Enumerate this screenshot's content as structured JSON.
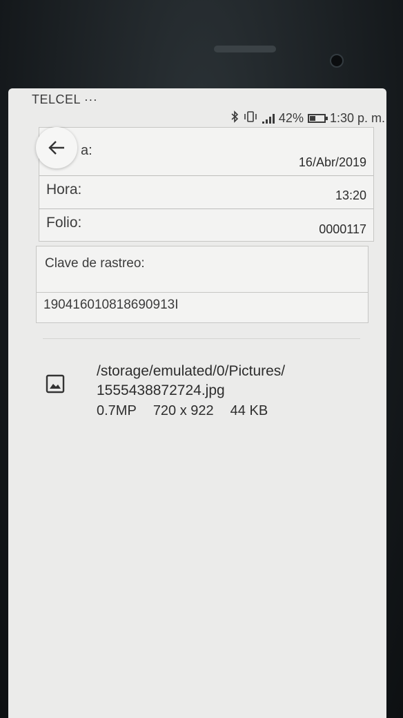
{
  "status_bar": {
    "carrier": "TELCEL ···",
    "battery_percent_text": "42%",
    "battery_level": 0.42,
    "time": "1:30 p. m."
  },
  "details": {
    "fecha_label_partial": "a:",
    "fecha_value": "16/Abr/2019",
    "hora_label": "Hora:",
    "hora_value": "13:20",
    "folio_label": "Folio:",
    "folio_value": "0000117"
  },
  "rastreo": {
    "label": "Clave de rastreo:",
    "value": "190416010818690913I"
  },
  "attachment": {
    "icon": "image-icon",
    "path_line1": "/storage/emulated/0/Pictures/",
    "path_line2": "1555438872724.jpg",
    "megapixels": "0.7MP",
    "dimensions": "720 x 922",
    "size": "44 KB"
  }
}
